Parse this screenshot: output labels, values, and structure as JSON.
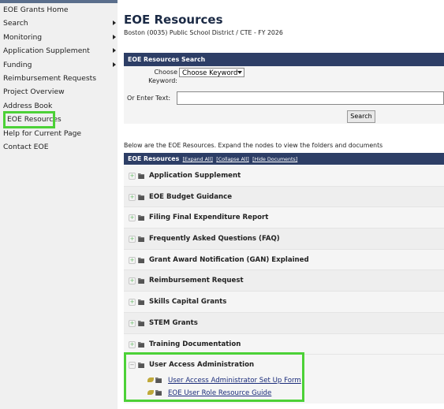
{
  "sidebar": {
    "items": [
      {
        "label": "EOE Grants Home",
        "arrow": false
      },
      {
        "label": "Search",
        "arrow": true
      },
      {
        "label": "Monitoring",
        "arrow": true
      },
      {
        "label": "Application Supplement",
        "arrow": true
      },
      {
        "label": "Funding",
        "arrow": true
      },
      {
        "label": "Reimbursement Requests",
        "arrow": false
      },
      {
        "label": "Project Overview",
        "arrow": false
      },
      {
        "label": "Address Book",
        "arrow": false
      },
      {
        "label": "EOE Resources",
        "arrow": false,
        "highlighted": true
      },
      {
        "label": "Help for Current Page",
        "arrow": false
      },
      {
        "label": "Contact EOE",
        "arrow": false
      }
    ]
  },
  "page": {
    "title": "EOE Resources",
    "subtitle": "Boston (0035) Public School District / CTE - FY 2026"
  },
  "search": {
    "header": "EOE Resources Search",
    "choose_label_1": "Choose",
    "choose_label_2": "Keyword:",
    "keyword_value": "Choose Keyword",
    "text_label": "Or Enter Text:",
    "button": "Search"
  },
  "tree": {
    "intro": "Below are the EOE Resources. Expand the nodes to view the folders and documents",
    "header": "EOE Resources",
    "expand_all": "[Expand All]",
    "collapse_all": "[Collapse All]",
    "hide_documents": "[Hide Documents]",
    "nodes": [
      "Application Supplement",
      "EOE Budget Guidance",
      "Filing Final Expenditure Report",
      "Frequently Asked Questions (FAQ)",
      "Grant Award Notification (GAN) Explained",
      "Reimbursement Request",
      "Skills Capital Grants",
      "STEM Grants",
      "Training Documentation"
    ],
    "expanded_node": "User Access Administration",
    "documents": [
      "User Access Administrator Set Up Form",
      "EOE User Role Resource Guide"
    ]
  },
  "colors": {
    "accent": "#2d3e66",
    "highlight": "#4cd137",
    "link": "#1a2c7a"
  }
}
